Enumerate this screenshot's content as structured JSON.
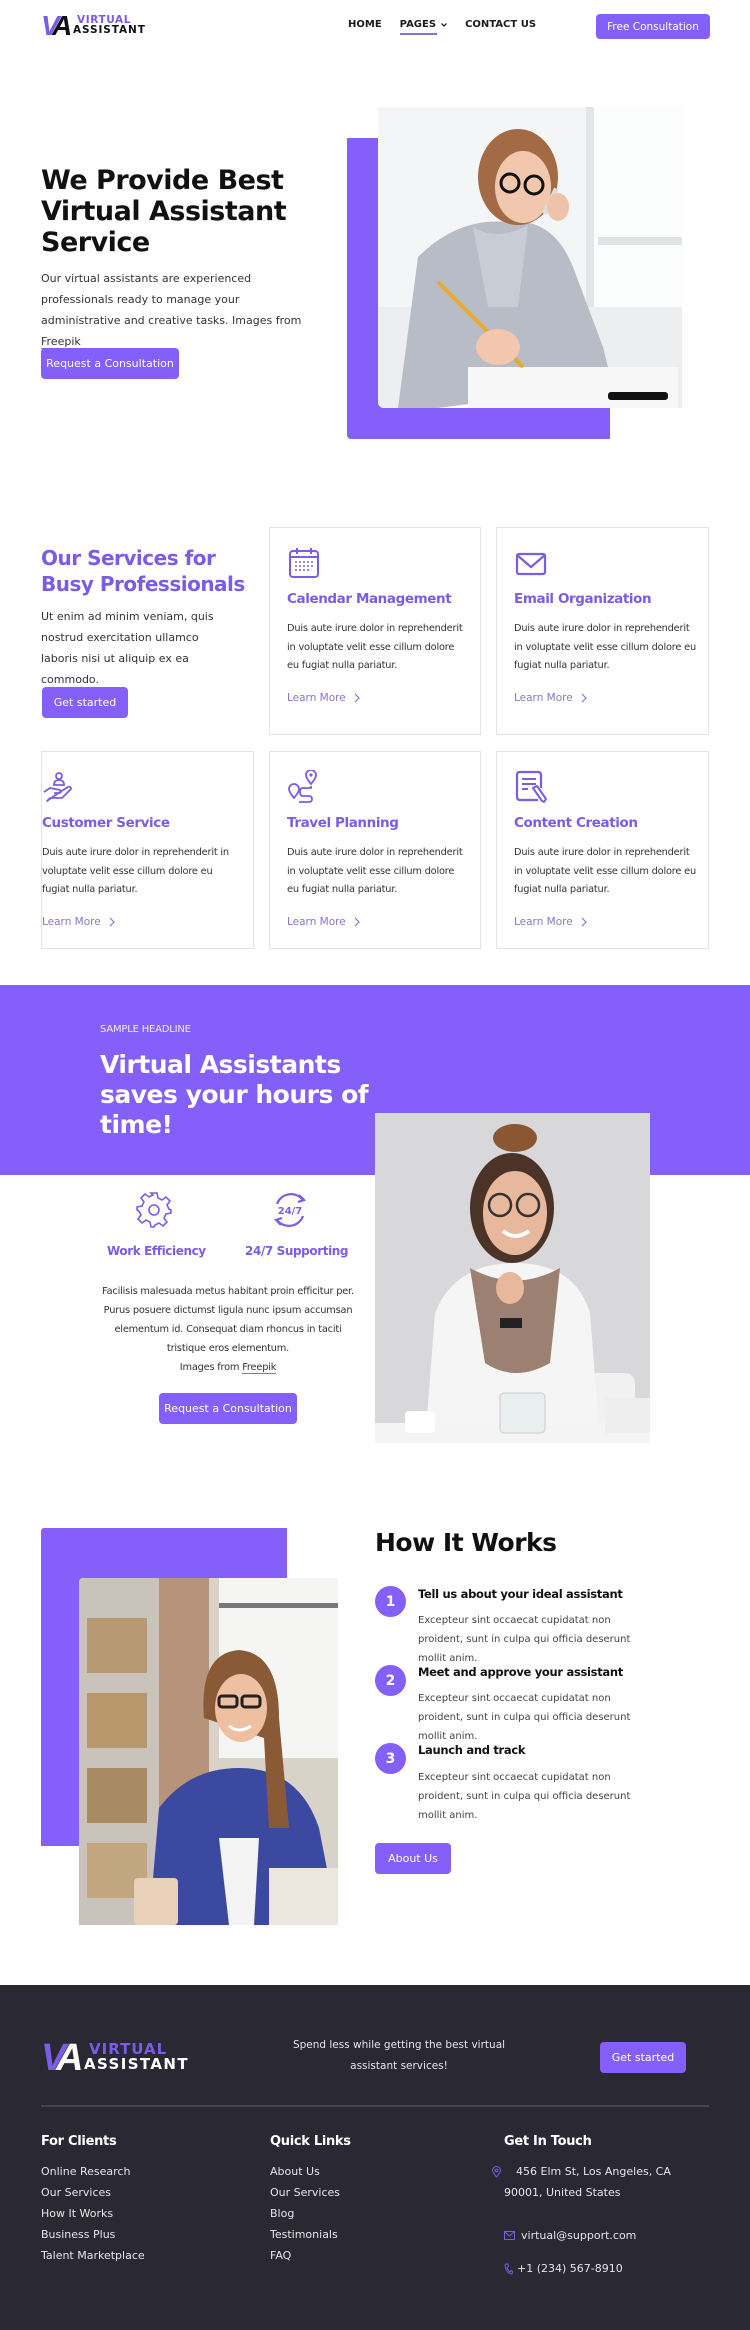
{
  "colors": {
    "accent": "#855ffa",
    "accent_text": "#7b5ce6",
    "dark_bg": "#2a2833"
  },
  "brand": {
    "logo_mark": "VA",
    "logo_line1": "VIRTUAL",
    "logo_line2": "ASSISTANT"
  },
  "nav": {
    "items": [
      {
        "label": "HOME"
      },
      {
        "label": "PAGES",
        "has_dropdown": true,
        "active": true
      },
      {
        "label": "CONTACT US"
      }
    ],
    "cta": "Free Consultation"
  },
  "hero": {
    "title_line1": "We Provide Best",
    "title_line2": "Virtual Assistant",
    "title_line3": "Service",
    "desc": "Our virtual assistants are experienced professionals ready to manage your administrative and creative tasks. Images from",
    "desc_link": "Freepik",
    "button": "Request a Consultation",
    "image_alt": "Woman on phone writing notes at desk"
  },
  "services": {
    "title_line1": "Our Services for",
    "title_line2": "Busy Professionals",
    "desc": "Ut enim ad minim veniam, quis nostrud exercitation ullamco laboris nisi ut aliquip ex ea commodo.",
    "button": "Get started",
    "learn_more": "Learn More",
    "cards": [
      {
        "icon": "calendar-icon",
        "title": "Calendar Management",
        "desc": "Duis aute irure dolor in reprehenderit in voluptate velit esse cillum dolore eu fugiat nulla pariatur."
      },
      {
        "icon": "envelope-icon",
        "title": "Email Organization",
        "desc": "Duis aute irure dolor in reprehenderit in voluptate velit esse cillum dolore eu fugiat nulla pariatur."
      },
      {
        "icon": "hand-person-icon",
        "title": "Customer Service",
        "desc": "Duis aute irure dolor in reprehenderit in voluptate velit esse cillum dolore eu fugiat nulla pariatur."
      },
      {
        "icon": "route-map-icon",
        "title": "Travel Planning",
        "desc": "Duis aute irure dolor in reprehenderit in voluptate velit esse cillum dolore eu fugiat nulla pariatur."
      },
      {
        "icon": "document-edit-icon",
        "title": "Content Creation",
        "desc": "Duis aute irure dolor in reprehenderit in voluptate velit esse cillum dolore eu fugiat nulla pariatur."
      }
    ]
  },
  "promo": {
    "eyebrow": "SAMPLE HEADLINE",
    "title_line1": "Virtual Assistants",
    "title_line2": "saves your hours of",
    "title_line3": "time!",
    "features": [
      {
        "icon": "gear-icon",
        "label": "Work Efficiency"
      },
      {
        "icon": "24-7-icon",
        "label": "24/7 Supporting"
      }
    ],
    "desc": "Facilisis malesuada metus habitant proin efficitur per. Purus posuere dictumst ligula nunc ipsum accumsan elementum id. Consequat diam rhoncus in taciti tristique eros elementum.",
    "images_from": "Images from",
    "images_link": "Freepik",
    "button": "Request a Consultation",
    "image_alt": "Smiling woman with glasses and scarf at table"
  },
  "how": {
    "title": "How It Works",
    "steps": [
      {
        "num": "1",
        "title": "Tell us about your ideal assistant",
        "desc": "Excepteur sint occaecat cupidatat non proident, sunt in culpa qui officia deserunt mollit anim."
      },
      {
        "num": "2",
        "title": "Meet and approve your assistant",
        "desc": "Excepteur sint occaecat cupidatat non proident, sunt in culpa qui officia deserunt mollit anim."
      },
      {
        "num": "3",
        "title": "Launch and track",
        "desc": "Excepteur sint occaecat cupidatat non proident, sunt in culpa qui officia deserunt mollit anim."
      }
    ],
    "button": "About Us",
    "image_alt": "Woman in blue blazer holding coffee cup"
  },
  "footer": {
    "tagline": "Spend less while getting the best virtual assistant services!",
    "cta": "Get started",
    "col1": {
      "title": "For Clients",
      "items": [
        "Online Research",
        "Our Services",
        "How It Works",
        "Business Plus",
        "Talent Marketplace"
      ]
    },
    "col2": {
      "title": "Quick Links",
      "items": [
        "About Us",
        "Our Services",
        "Blog",
        "Testimonials",
        "FAQ"
      ]
    },
    "col3": {
      "title": "Get In Touch",
      "address": "456 Elm St, Los Angeles, CA 90001, United States",
      "email": "virtual@support.com",
      "phone": "+1 (234) 567-8910"
    }
  }
}
